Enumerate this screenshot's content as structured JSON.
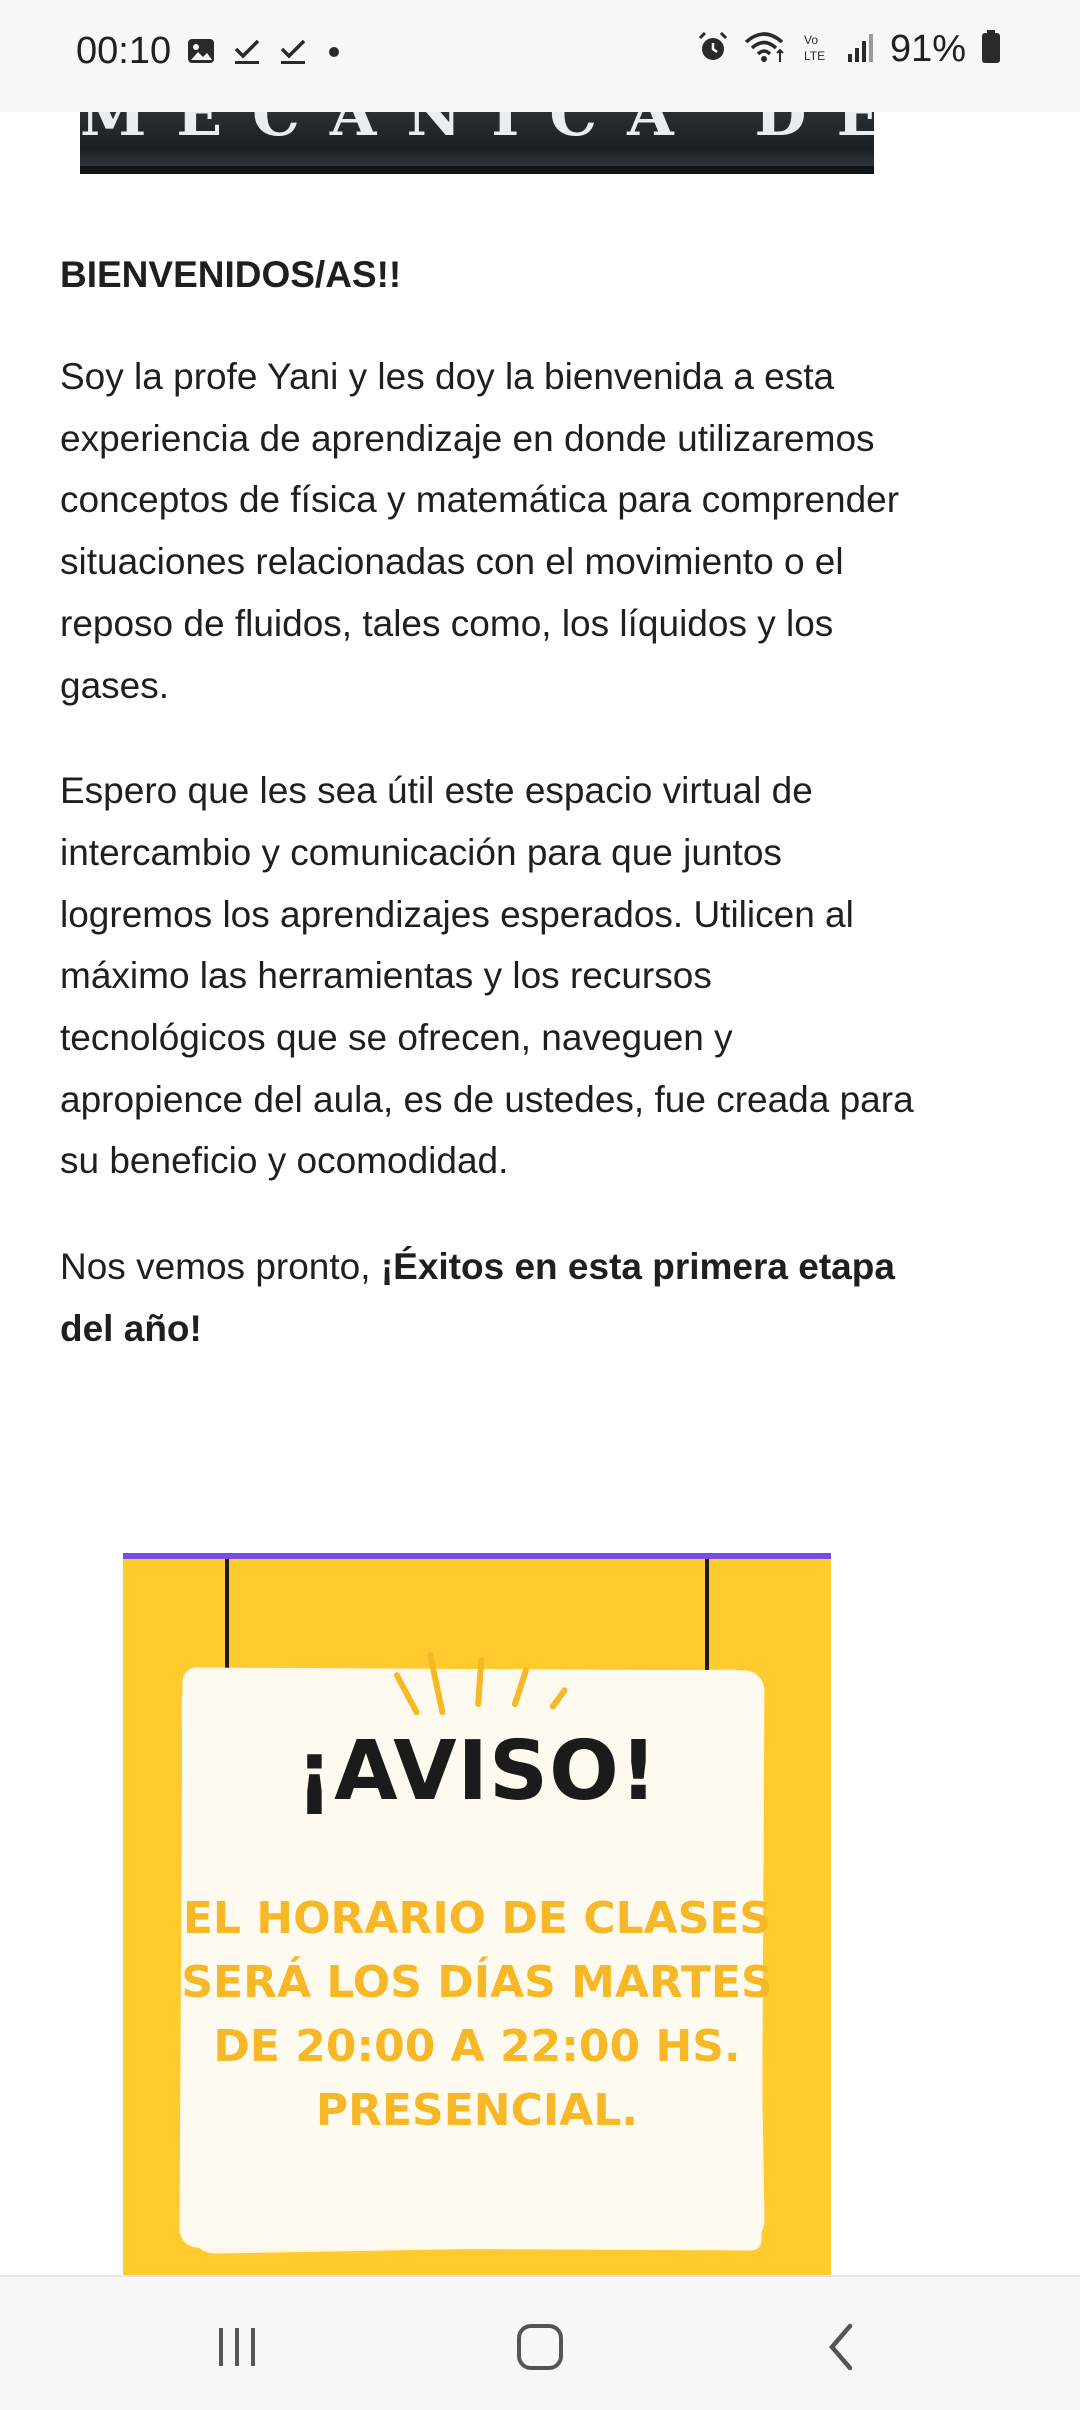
{
  "status_bar": {
    "time": "00:10",
    "battery": "91%",
    "left_icons": [
      "image-icon",
      "check-icon",
      "check-icon",
      "dot-icon"
    ],
    "right_icons": [
      "alarm-icon",
      "wifi-icon",
      "volte-icon",
      "signal-icon",
      "battery-icon"
    ]
  },
  "banner": {
    "text": "MECANICA DE FLUIDOS"
  },
  "article": {
    "heading": "BIENVENIDOS/AS!!",
    "paragraph1": "Soy la profe Yani y les doy la bienvenida a esta experiencia de aprendizaje en donde utilizaremos conceptos de física y matemática para comprender situaciones relacionadas con el movimiento o el reposo de fluidos, tales como, los líquidos y los gases.",
    "paragraph2": "Espero que les sea útil este espacio virtual de intercambio y comunicación para que juntos logremos los aprendizajes esperados. Utilicen al máximo las herramientas y los recursos tecnológicos que se ofrecen, naveguen y apropience del aula, es de ustedes, fue creada para su beneficio y ocomodidad.",
    "paragraph3_normal": "Nos vemos pronto, ",
    "paragraph3_bold": "¡Éxitos en esta primera etapa del año!"
  },
  "poster": {
    "title": "¡AVISO!",
    "lines": [
      "EL HORARIO DE CLASES",
      "SERÁ LOS DÍAS MARTES",
      "DE 20:00 A 22:00 HS.",
      "PRESENCIAL."
    ],
    "colors": {
      "background": "#ffcb2e",
      "accent": "#f6b827",
      "top_border": "#7b4ce0"
    }
  },
  "nav_bar": {
    "buttons": [
      "recents-icon",
      "home-icon",
      "back-icon"
    ]
  }
}
